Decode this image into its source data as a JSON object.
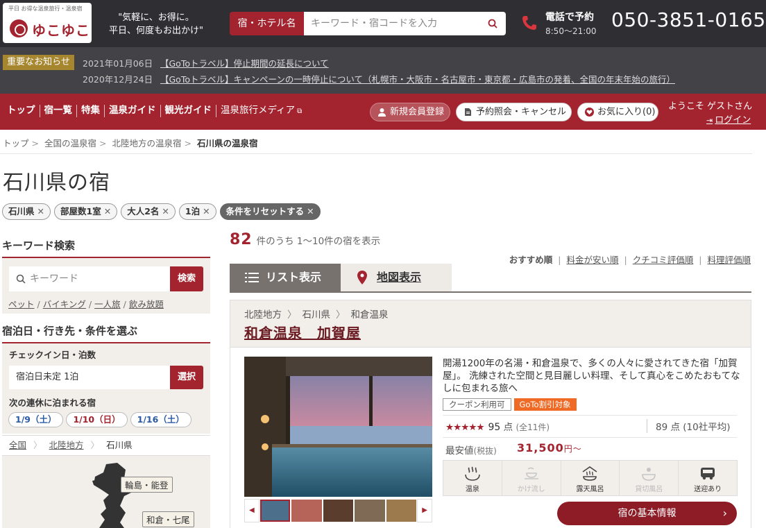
{
  "header": {
    "logo_tagline": "平日 お得な温泉旅行・温泉宿",
    "logo_text": "ゆこゆこ",
    "slogan_line1": "\"気軽に、お得に。",
    "slogan_line2": "平日、何度もお出かけ\"",
    "search_label": "宿・ホテル名",
    "search_placeholder": "キーワード・宿コードを入力",
    "phone_title": "電話で予約",
    "phone_hours": "8:50〜21:00",
    "phone_number": "050-3851-0165"
  },
  "notice": {
    "badge": "重要なお知らせ",
    "items": [
      {
        "date": "2021年01月06日",
        "text": "【GoToトラベル】停止期間の延長について"
      },
      {
        "date": "2020年12月24日",
        "text": "【GoToトラベル】キャンペーンの一時停止について（札幌市・大阪市・名古屋市・東京都・広島市の発着、全国の年末年始の旅行）"
      }
    ]
  },
  "nav": {
    "items": [
      "トップ",
      "宿一覧",
      "特集",
      "温泉ガイド",
      "観光ガイド",
      "温泉旅行メディア"
    ],
    "member_button": "新規会員登録",
    "reserve_button": "予約照会・キャンセル",
    "favorites_button": "お気に入り(0)",
    "welcome": "ようこそ ゲストさん",
    "login": "ログイン"
  },
  "breadcrumb": [
    "トップ",
    "全国の温泉宿",
    "北陸地方の温泉宿",
    "石川県の温泉宿"
  ],
  "page_title": "石川県の宿",
  "chips": [
    "石川県",
    "部屋数1室",
    "大人2名",
    "1泊"
  ],
  "reset_chip": "条件をリセットする",
  "sidebar": {
    "keyword_heading": "キーワード検索",
    "keyword_placeholder": "キーワード",
    "keyword_button": "検索",
    "keyword_tags": [
      "ペット",
      "バイキング",
      "一人旅",
      "飲み放題"
    ],
    "condition_heading": "宿泊日・行き先・条件を選ぶ",
    "checkin_label": "チェックイン日・泊数",
    "checkin_value": "宿泊日未定 1泊",
    "checkin_button": "選択",
    "holiday_label": "次の連休に泊まれる宿",
    "holidays": [
      "1/9（土）",
      "1/10（日）",
      "1/16（土）"
    ],
    "region_crumb": [
      "全国",
      "北陸地方",
      "石川県"
    ],
    "map_labels": [
      "輪島・能登",
      "和倉・七尾"
    ]
  },
  "results": {
    "count": "82",
    "count_text": "件のうち 1〜10件の宿を表示",
    "sort_current": "おすすめ順",
    "sorts": [
      "料金が安い順",
      "クチコミ評価順",
      "料理評価順"
    ],
    "tab_list": "リスト表示",
    "tab_map": "地図表示"
  },
  "hotel": {
    "path": [
      "北陸地方",
      "石川県",
      "和倉温泉"
    ],
    "name": "和倉温泉　加賀屋",
    "description": "開湯1200年の名湯・和倉温泉で、多くの人々に愛されてきた宿「加賀屋」。 洗練された空間と見目麗しい料理、そして真心をこめたおもてなしに包まれる旅へ",
    "badge_coupon": "クーポン利用可",
    "badge_goto": "GoTo割引対象",
    "stars": "★★★★★",
    "rating": "95",
    "rating_unit": "点",
    "rating_note": "(全11件)",
    "rating2": "89",
    "rating2_unit": "点",
    "rating2_note": "(10社平均)",
    "price_label": "最安値",
    "price_note": "(税抜)",
    "price": "31,500",
    "price_unit": "円〜",
    "amenities": [
      {
        "label": "温泉",
        "icon": "hot-spring-icon",
        "active": true
      },
      {
        "label": "かけ流し",
        "icon": "flowing-spring-icon",
        "active": false
      },
      {
        "label": "露天風呂",
        "icon": "open-air-bath-icon",
        "active": true
      },
      {
        "label": "貸切風呂",
        "icon": "private-bath-icon",
        "active": false
      },
      {
        "label": "送迎あり",
        "icon": "shuttle-bus-icon",
        "active": true
      }
    ],
    "info_button": "宿の基本情報"
  },
  "colors": {
    "brand": "#a3232e",
    "header_bg": "#2f2e33",
    "notice_bg": "#434247",
    "badge_gold": "#a6862f",
    "goto_orange": "#ef6b25"
  }
}
